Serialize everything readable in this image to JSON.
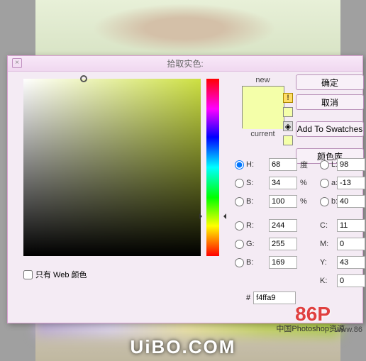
{
  "dialog": {
    "title": "拾取实色:",
    "buttons": {
      "ok": "确定",
      "cancel": "取消",
      "add_swatch": "Add To Swatches",
      "color_lib": "颜色库"
    },
    "preview": {
      "new_label": "new",
      "current_label": "current"
    },
    "hsb": {
      "h_label": "H:",
      "h_val": "68",
      "h_unit": "度",
      "s_label": "S:",
      "s_val": "34",
      "s_unit": "%",
      "b_label": "B:",
      "b_val": "100",
      "b_unit": "%"
    },
    "rgb": {
      "r_label": "R:",
      "r_val": "244",
      "g_label": "G:",
      "g_val": "255",
      "b_label": "B:",
      "b_val": "169"
    },
    "lab": {
      "l_label": "L:",
      "l_val": "98",
      "a_label": "a:",
      "a_val": "-13",
      "b_label": "b:",
      "b_val": "40"
    },
    "cmyk": {
      "c_label": "C:",
      "c_val": "11",
      "c_unit": "%",
      "m_label": "M:",
      "m_val": "0",
      "m_unit": "%",
      "y_label": "Y:",
      "y_val": "43",
      "y_unit": "%",
      "k_label": "K:",
      "k_val": "0",
      "k_unit": "%"
    },
    "hex": {
      "label": "#",
      "val": "f4ffa9"
    },
    "web_only": "只有 Web 颜色"
  },
  "watermark": {
    "logo": "86P",
    "cn": "中国Photoshop资源",
    "site": "www.86",
    "footer": "UiBO.COM"
  },
  "chart_data": {
    "type": "other",
    "note": "Photoshop color picker; selected color hex f4ffa9",
    "hsb": [
      68,
      34,
      100
    ],
    "rgb": [
      244,
      255,
      169
    ],
    "lab": [
      98,
      -13,
      40
    ],
    "cmyk": [
      11,
      0,
      43,
      0
    ]
  }
}
